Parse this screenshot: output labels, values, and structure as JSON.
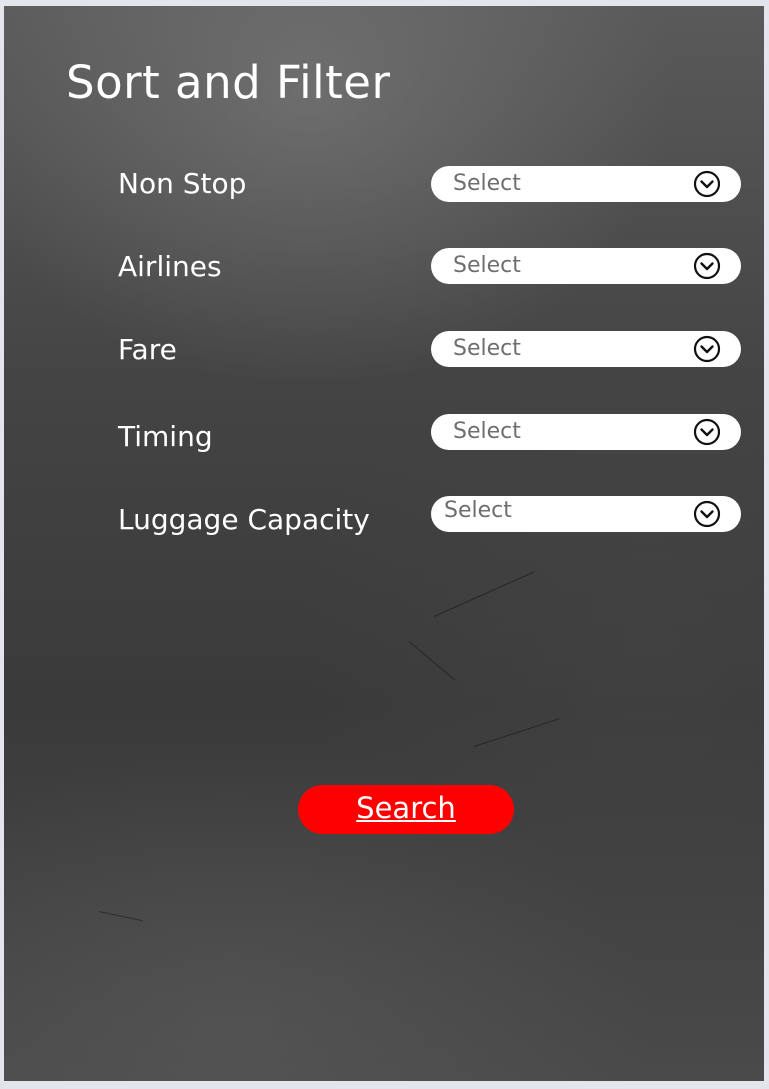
{
  "panel": {
    "title": "Sort and Filter"
  },
  "filters": [
    {
      "label": "Non Stop",
      "value": "Select",
      "icon": "chevron-down-circle-icon"
    },
    {
      "label": "Airlines",
      "value": "Select",
      "icon": "chevron-down-circle-icon"
    },
    {
      "label": "Fare",
      "value": "Select",
      "icon": "chevron-down-circle-icon"
    },
    {
      "label": "Timing",
      "value": "Select",
      "icon": "chevron-down-circle-icon"
    },
    {
      "label": "Luggage Capacity",
      "value": "Select",
      "icon": "chevron-down-circle-icon"
    }
  ],
  "actions": {
    "search_label": "Search"
  },
  "colors": {
    "accent": "#ff0000",
    "text": "#ffffff",
    "select_bg": "#ffffff",
    "select_text": "#6e6e6e"
  }
}
